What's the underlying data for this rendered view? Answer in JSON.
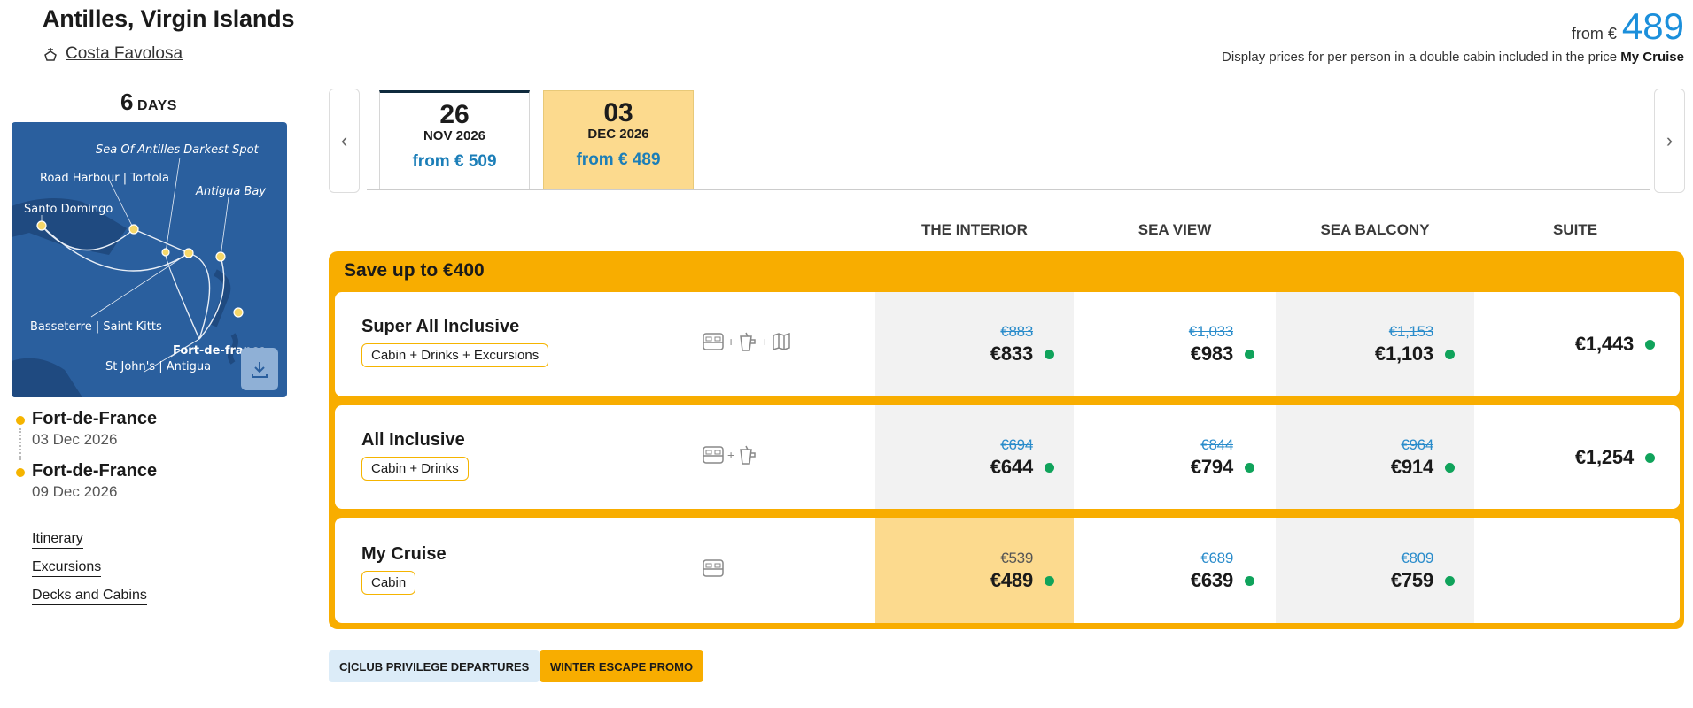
{
  "header": {
    "title": "Antilles, Virgin Islands",
    "ship": "Costa Favolosa",
    "from_label": "from €",
    "from_value": "489",
    "price_note_prefix": "Display prices for per person in a double cabin included in the price",
    "price_note_bold": "My Cruise"
  },
  "itinerary": {
    "days_num": "6",
    "days_label": "DAYS",
    "map_labels": [
      "Sea Of Antilles Darkest Spot",
      "Road Harbour | Tortola",
      "Antigua Bay",
      "Santo Domingo",
      "Basseterre | Saint Kitts",
      "Fort-de-france",
      "St John's | Antigua"
    ],
    "stops": [
      {
        "city": "Fort-de-France",
        "date": "03 Dec 2026"
      },
      {
        "city": "Fort-de-France",
        "date": "09 Dec 2026"
      }
    ],
    "links": [
      "Itinerary",
      "Excursions",
      "Decks and Cabins"
    ]
  },
  "dates": [
    {
      "day": "26",
      "month": "NOV 2026",
      "price": "from € 509",
      "selected": false
    },
    {
      "day": "03",
      "month": "DEC 2026",
      "price": "from € 489",
      "selected": true
    }
  ],
  "columns": [
    "THE INTERIOR",
    "SEA VIEW",
    "SEA BALCONY",
    "SUITE"
  ],
  "promo": "Save up to €400",
  "packages": [
    {
      "name": "Super All Inclusive",
      "tag": "Cabin + Drinks + Excursions",
      "prices": [
        {
          "old": "€883",
          "new": "€833"
        },
        {
          "old": "€1,033",
          "new": "€983"
        },
        {
          "old": "€1,153",
          "new": "€1,103"
        },
        {
          "old": "",
          "new": "€1,443"
        }
      ]
    },
    {
      "name": "All Inclusive",
      "tag": "Cabin + Drinks",
      "prices": [
        {
          "old": "€694",
          "new": "€644"
        },
        {
          "old": "€844",
          "new": "€794"
        },
        {
          "old": "€964",
          "new": "€914"
        },
        {
          "old": "",
          "new": "€1,254"
        }
      ]
    },
    {
      "name": "My Cruise",
      "tag": "Cabin",
      "prices": [
        {
          "old": "€539",
          "new": "€489"
        },
        {
          "old": "€689",
          "new": "€639"
        },
        {
          "old": "€809",
          "new": "€759"
        },
        {
          "old": "",
          "new": ""
        }
      ]
    }
  ],
  "badges": [
    "C|CLUB PRIVILEGE DEPARTURES",
    "WINTER ESCAPE PROMO"
  ],
  "colors": {
    "accent": "#f8ad00",
    "selected": "#fcda8e",
    "price_blue": "#1b8fdb",
    "available": "#10a35b"
  }
}
